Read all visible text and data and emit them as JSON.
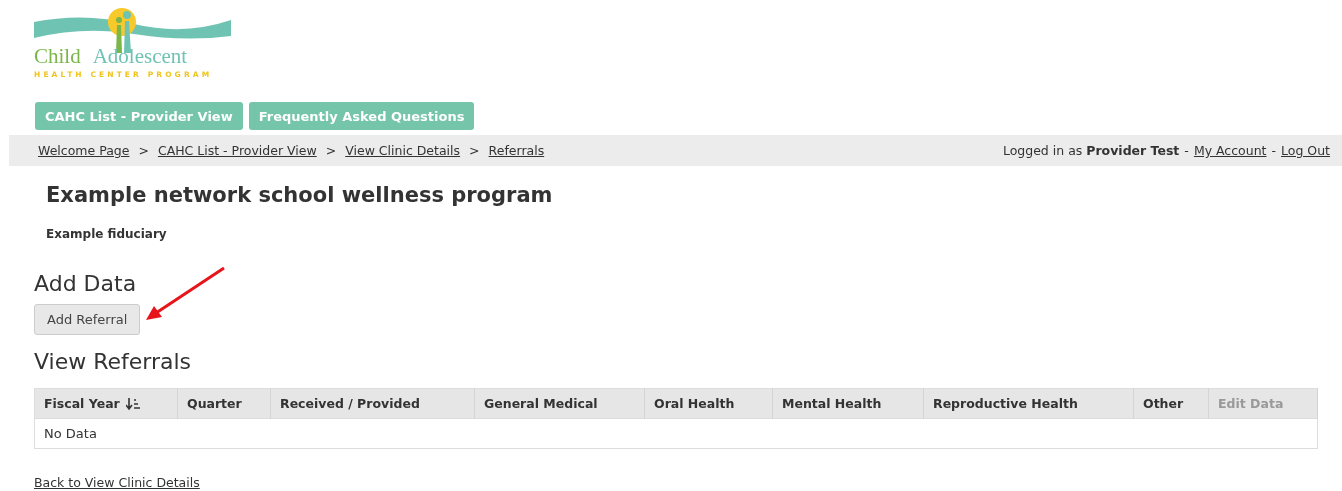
{
  "logo": {
    "word_1": "Child",
    "word_2": "Adolescent",
    "tagline": "HEALTH CENTER PROGRAM"
  },
  "nav": [
    {
      "label": "CAHC List - Provider View"
    },
    {
      "label": "Frequently Asked Questions"
    }
  ],
  "breadcrumbs": [
    {
      "label": "Welcome Page"
    },
    {
      "label": "CAHC List - Provider View"
    },
    {
      "label": "View Clinic Details"
    },
    {
      "label": "Referrals"
    }
  ],
  "breadcrumb_separator": ">",
  "account": {
    "prefix": "Logged in as",
    "user": "Provider Test",
    "separator": "-",
    "links": [
      "My Account",
      "Log Out"
    ]
  },
  "title": "Example network school wellness program",
  "subtitle": "Example fiduciary",
  "add_section": {
    "heading": "Add Data",
    "button": "Add Referral"
  },
  "view_section": {
    "heading": "View Referrals"
  },
  "table": {
    "columns": [
      {
        "label": "Fiscal Year",
        "sorted": true,
        "disabled": false
      },
      {
        "label": "Quarter",
        "sorted": false,
        "disabled": false
      },
      {
        "label": "Received / Provided",
        "sorted": false,
        "disabled": false
      },
      {
        "label": "General Medical",
        "sorted": false,
        "disabled": false
      },
      {
        "label": "Oral Health",
        "sorted": false,
        "disabled": false
      },
      {
        "label": "Mental Health",
        "sorted": false,
        "disabled": false
      },
      {
        "label": "Reproductive Health",
        "sorted": false,
        "disabled": false
      },
      {
        "label": "Other",
        "sorted": false,
        "disabled": false
      },
      {
        "label": "Edit Data",
        "sorted": false,
        "disabled": true
      }
    ],
    "empty_message": "No Data"
  },
  "back_link": "Back to View Clinic Details"
}
